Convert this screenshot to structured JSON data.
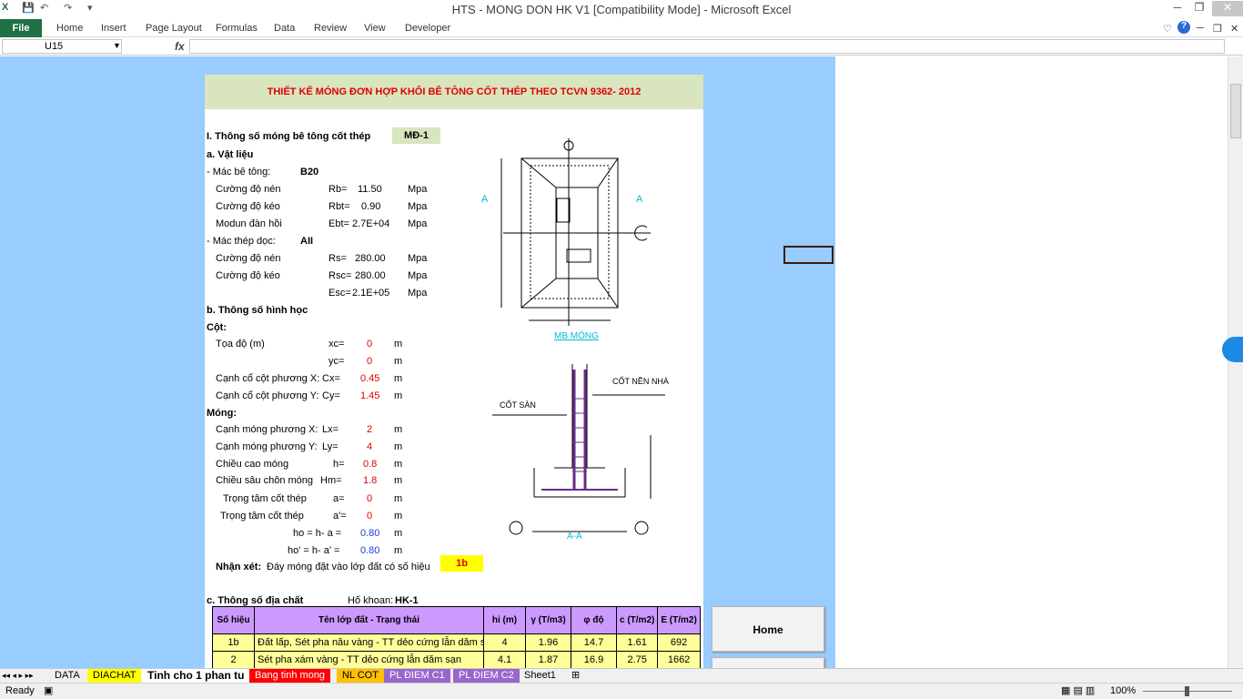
{
  "window": {
    "title": "HTS - MONG DON  HK V1  [Compatibility Mode] - Microsoft Excel"
  },
  "ribbon": {
    "file": "File",
    "tabs": [
      "Home",
      "Insert",
      "Page Layout",
      "Formulas",
      "Data",
      "Review",
      "View",
      "Developer"
    ]
  },
  "formula_bar": {
    "name_box": "U15",
    "fx": "fx",
    "value": ""
  },
  "sheet": {
    "title": "THIẾT KẾ MÓNG ĐƠN HỢP KHỐI BÊ TÔNG CỐT THÉP THEO TCVN 9362- 2012",
    "section1": "I. Thông số móng bê tông cốt thép",
    "code": "MĐ-1",
    "sec_a": "a. Vật liệu",
    "concrete_grade_label": "- Mác bê tông:",
    "concrete_grade": "B20",
    "steel_grade_label": "- Mác thép dọc:",
    "steel_grade": "AII",
    "materials": [
      {
        "label": "Cường độ nén",
        "sym": "Rb=",
        "val": "11.50",
        "unit": "Mpa"
      },
      {
        "label": "Cường độ kéo",
        "sym": "Rbt=",
        "val": "0.90",
        "unit": "Mpa"
      },
      {
        "label": "Modun đàn hồi",
        "sym": "Ebt=",
        "val": "2.7E+04",
        "unit": "Mpa"
      },
      {
        "label": "Cường độ nén",
        "sym": "Rs=",
        "val": "280.00",
        "unit": "Mpa"
      },
      {
        "label": "Cường độ kéo",
        "sym": "Rsc=",
        "val": "280.00",
        "unit": "Mpa"
      },
      {
        "label": "",
        "sym": "Esc=",
        "val": "2.1E+05",
        "unit": "Mpa"
      }
    ],
    "sec_b": "b. Thông số hình học",
    "col_head": "Cột:",
    "col_rows": [
      {
        "label": "Tọa độ (m)",
        "sym": "xc=",
        "val": "0",
        "unit": "m"
      },
      {
        "label": "",
        "sym": "yc=",
        "val": "0",
        "unit": "m"
      },
      {
        "label": "Cạnh cổ cột phương X:",
        "sym": "Cx=",
        "val": "0.45",
        "unit": "m"
      },
      {
        "label": "Cạnh cổ cột phương Y:",
        "sym": "Cy=",
        "val": "1.45",
        "unit": "m"
      }
    ],
    "found_head": "Móng:",
    "found_rows": [
      {
        "label": "Cạnh móng phương X:",
        "sym": "Lx=",
        "val": "2",
        "unit": "m"
      },
      {
        "label": "Cạnh móng phương Y:",
        "sym": "Ly=",
        "val": "4",
        "unit": "m"
      },
      {
        "label": "Chiều cao móng",
        "sym": "h=",
        "val": "0.8",
        "unit": "m"
      },
      {
        "label": "Chiều sâu chôn móng",
        "sym": "Hm=",
        "val": "1.8",
        "unit": "m"
      },
      {
        "label": "Trọng tâm cốt thép",
        "sym": "a=",
        "val": "0",
        "unit": "m"
      },
      {
        "label": "Trọng tâm cốt thép",
        "sym": "a'=",
        "val": "0",
        "unit": "m"
      },
      {
        "label": "",
        "sym": "ho = h- a =",
        "val": "0.80",
        "unit": "m"
      },
      {
        "label": "",
        "sym": "ho' = h- a' =",
        "val": "0.80",
        "unit": "m"
      }
    ],
    "remark_label": "Nhận xét:",
    "remark_text": "Đáy móng đặt vào lớp đất có số hiệu",
    "remark_value": "1b",
    "sec_c": "c. Thông số địa chất",
    "borehole_label": "Hố khoan:",
    "borehole": "HK-1",
    "soil_headers": [
      "Số hiệu",
      "Tên lớp đất - Trạng thái",
      "hi (m)",
      "γ (T/m3)",
      "φ độ",
      "c (T/m2)",
      "E (T/m2)"
    ],
    "soil_rows": [
      [
        "1b",
        "Đất lấp, Sét pha nâu vàng - TT dẻo cứng lẫn dăm s",
        "4",
        "1.96",
        "14.7",
        "1.61",
        "692"
      ],
      [
        "2",
        "Sét pha xám vàng - TT dẻo cứng lẫn dăm sạn",
        "4.1",
        "1.87",
        "16.9",
        "2.75",
        "1662"
      ]
    ],
    "diagram": {
      "plan_title": "MB MÓNG",
      "section_title": "A-A",
      "cut_label": "A",
      "cot_nen": "CỐT NỀN NHÀ",
      "cot_san": "CỐT SÀN"
    }
  },
  "buttons": {
    "home": "Home"
  },
  "sheet_tabs": [
    "DATA",
    "DIACHAT",
    "Tinh cho 1 phan tu",
    "Bang tinh mong",
    "NL COT",
    "PL ĐIEM C1",
    "PL ĐIEM C2",
    "Sheet1"
  ],
  "status": {
    "ready": "Ready",
    "zoom": "100%"
  }
}
